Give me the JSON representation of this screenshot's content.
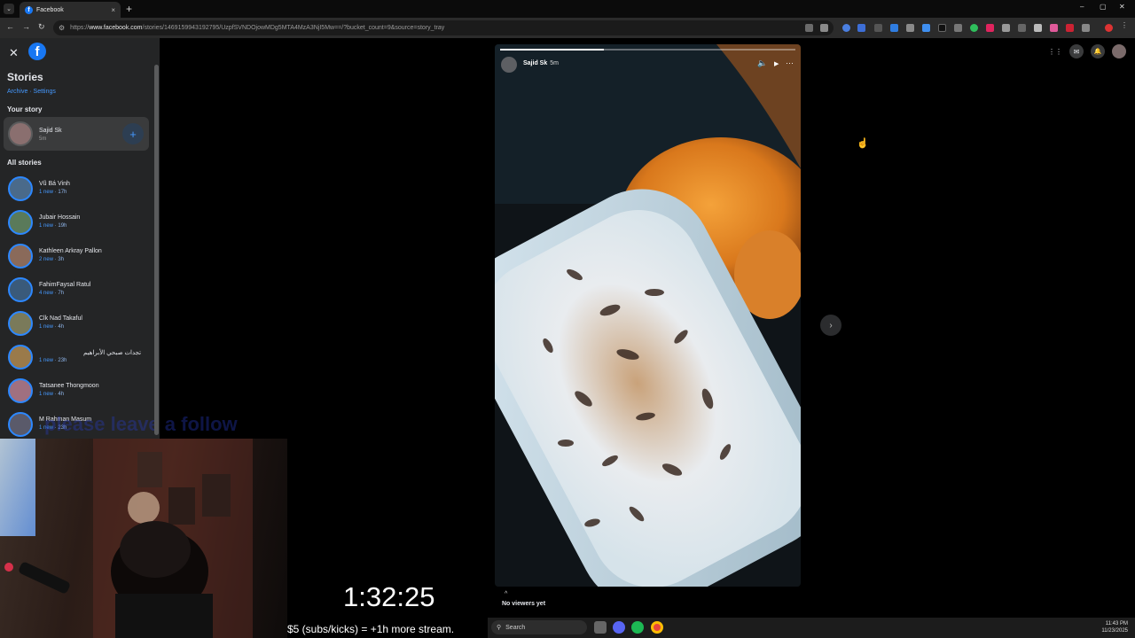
{
  "browser": {
    "tab_title": "Facebook",
    "tab_close": "×",
    "new_tab": "+",
    "url_prefix": "https://",
    "url_domain": "www.facebook.com",
    "url_path": "/stories/1469159943192795/UzpfSVNDOjowMDg5MTA4MzA3NjI5Mw==/?bucket_count=9&source=story_tray",
    "controls": {
      "back": "←",
      "forward": "→",
      "reload": "↻",
      "minimize": "–",
      "restore": "▢",
      "close": "✕",
      "tab_menu": "⌄"
    }
  },
  "sidebar": {
    "close": "✕",
    "logo": "f",
    "title": "Stories",
    "links": "Archive · Settings",
    "your_story_heading": "Your story",
    "my_story": {
      "name": "Sajid Sk",
      "time": "5m",
      "add": "+"
    },
    "all_stories_heading": "All stories",
    "stories": [
      {
        "name": "Vũ Bá Vinh",
        "new": "1 new",
        "time": "17h"
      },
      {
        "name": "Jubair Hossain",
        "new": "1 new",
        "time": "19h"
      },
      {
        "name": "Kathleen Arkray Pallon",
        "new": "2 new",
        "time": "3h"
      },
      {
        "name": "FahimFaysal Ratul",
        "new": "4 new",
        "time": "7h"
      },
      {
        "name": "Clk Nad Takaful",
        "new": "1 new",
        "time": "4h"
      },
      {
        "name": "تجدات صبحي الأبراهيم",
        "new": "1 new",
        "time": "23h"
      },
      {
        "name": "Tatsanee Thongmoon",
        "new": "1 new",
        "time": "4h"
      },
      {
        "name": "M Rahman Masum",
        "new": "1 new",
        "time": "23h"
      }
    ],
    "overlay_text": "please leave a follow"
  },
  "story": {
    "author": "Sajid Sk",
    "time": "5m",
    "progress": 0.35,
    "mute": "🔈",
    "play": "▶",
    "more": "···",
    "no_viewers": "No viewers yet",
    "up": "^",
    "next": "›"
  },
  "fb_header": {
    "menu": "⋮⋮",
    "messenger": "✉",
    "notifications": "🔔"
  },
  "stream": {
    "timer": "1:32:25",
    "message": "$5 (subs/kicks) = +1h more stream."
  },
  "taskbar": {
    "search": "Search",
    "time": "11:43 PM",
    "date": "11/23/2025"
  }
}
